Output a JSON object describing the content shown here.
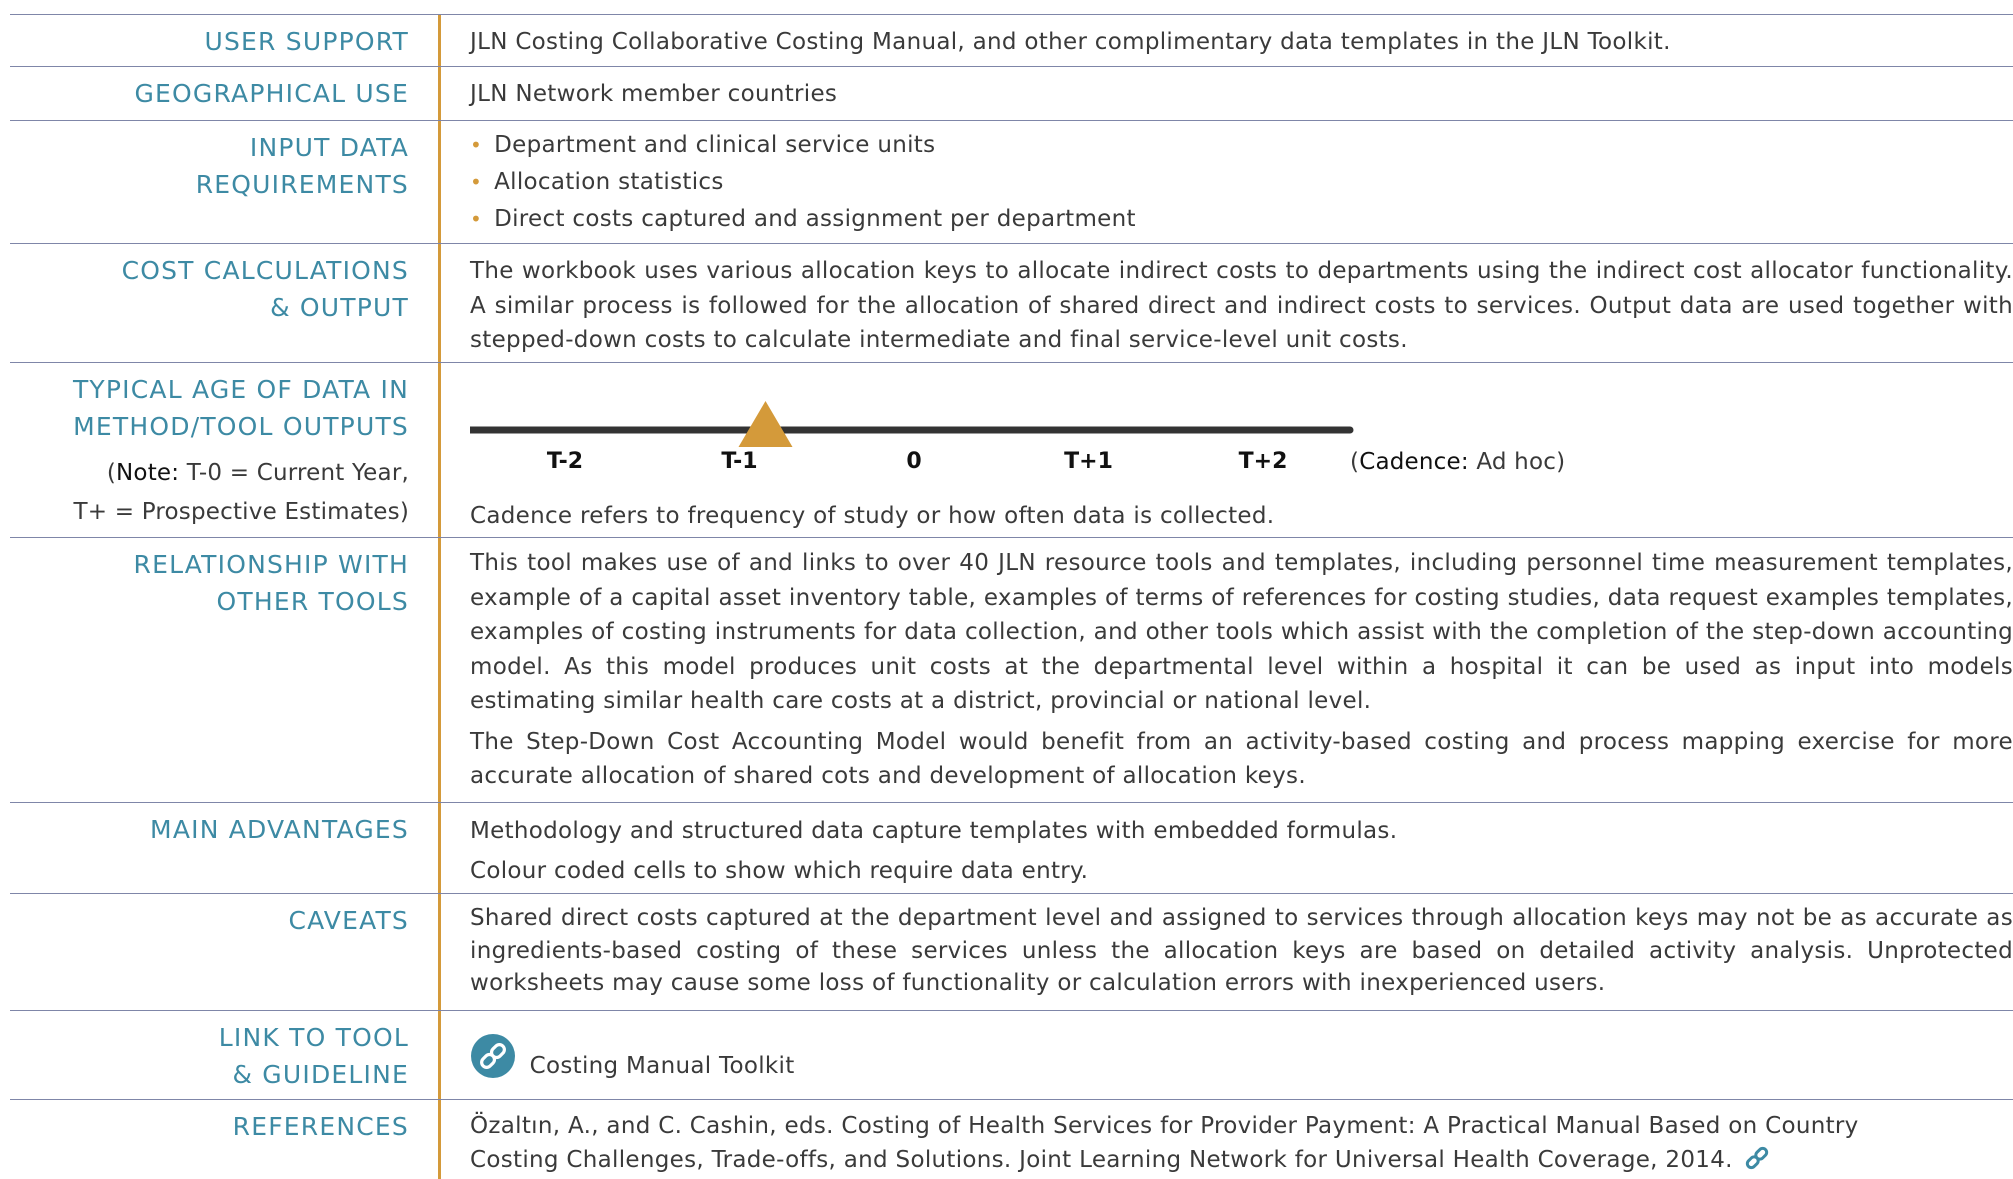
{
  "rows": {
    "user_support": {
      "label": "USER SUPPORT",
      "value": "JLN Costing Collaborative Costing Manual, and other complimentary data templates in the JLN Toolkit."
    },
    "geographical_use": {
      "label": "GEOGRAPHICAL USE",
      "value": "JLN Network member countries"
    },
    "input_data": {
      "label_line1": "INPUT DATA",
      "label_line2": "REQUIREMENTS",
      "items": [
        "Department and clinical service units",
        "Allocation statistics",
        "Direct costs captured and assignment per department"
      ]
    },
    "cost_calc": {
      "label_line1": "COST CALCULATIONS",
      "label_line2": "& OUTPUT",
      "value": "The workbook uses various allocation keys to allocate indirect costs to departments using the indirect cost allocator functionality. A similar process is followed for the allocation of shared direct and indirect costs to services. Output data are used together with stepped-down costs to calculate intermediate and final service-level unit costs."
    },
    "typical_age": {
      "label_line1": "TYPICAL AGE OF DATA IN",
      "label_line2": "METHOD/TOOL OUTPUTS",
      "note_bold": "Note:",
      "note_open": "(",
      "note_line1_rest": " T-0 = Current Year,",
      "note_line2": "T+ = Prospective Estimates)",
      "timeline": {
        "ticks": [
          "T-2",
          "T-1",
          "0",
          "T+1",
          "T+2"
        ],
        "marker_value": "T-1",
        "marker_color": "#d49a3a",
        "cadence_label": "Cadence:",
        "cadence_open": "(",
        "cadence_value": " Ad hoc)"
      },
      "footnote": "Cadence refers to frequency of study or how often data is collected."
    },
    "relationship": {
      "label_line1": "RELATIONSHIP WITH",
      "label_line2": "OTHER TOOLS",
      "para1": "This tool makes use of and links to over 40 JLN resource tools and templates, including personnel time measurement templates, example of a capital asset inventory table, examples of terms of references for costing studies, data request examples templates, examples of costing instruments for data collection, and other tools which assist with the completion of the step-down accounting model. As this model produces unit costs at the departmental level within a hospital it can be used as input into models estimating similar health care costs at a district, provincial or national level.",
      "para2": "The Step-Down Cost Accounting Model would benefit from an activity-based costing and process mapping exercise for more accurate allocation of shared cots and development of allocation keys."
    },
    "main_advantages": {
      "label": "MAIN ADVANTAGES",
      "items": [
        "Methodology and structured data capture templates with embedded formulas.",
        "Colour coded cells to show which require data entry."
      ]
    },
    "caveats": {
      "label": "CAVEATS",
      "value": "Shared direct costs captured at the department level and assigned to services through allocation keys may not be as accurate as ingredients-based costing of these services unless the allocation keys are based on detailed activity analysis. Unprotected worksheets may cause some loss of functionality or calculation errors with inexperienced users."
    },
    "link_to_tool": {
      "label_line1": "LINK TO TOOL",
      "label_line2": "& GUIDELINE",
      "link_text": "Costing Manual Toolkit",
      "icon": "link-icon"
    },
    "references": {
      "label": "REFERENCES",
      "line1": "Özaltın, A., and C. Cashin, eds. Costing of Health Services for Provider Payment: A Practical Manual Based on Country",
      "line2": "Costing Challenges, Trade-offs, and Solutions. Joint Learning Network for Universal Health Coverage, 2014.",
      "icon": "link-icon"
    }
  },
  "colors": {
    "label": "#3d8aa4",
    "accent": "#d49a3a",
    "rule": "#7f86a8",
    "text": "#3a3a3a"
  }
}
